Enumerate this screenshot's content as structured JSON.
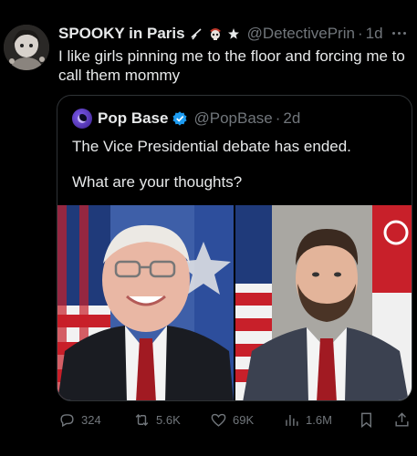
{
  "tweet": {
    "display_name": "SPOOKY in Paris",
    "name_emoji": [
      "scissors-icon",
      "pirate-skull-icon",
      "star-icon"
    ],
    "handle": "@DetectivePrin",
    "dot": "·",
    "time": "1d",
    "text": "I like girls pinning me to the floor and forcing me to call them mommy"
  },
  "quote": {
    "display_name": "Pop Base",
    "verified": true,
    "handle": "@PopBase",
    "dot": "·",
    "time": "2d",
    "line1": "The Vice Presidential debate has ended.",
    "line2": "What are your thoughts?"
  },
  "actions": {
    "replies": "324",
    "reposts": "5.6K",
    "likes": "69K",
    "views": "1.6M"
  },
  "colors": {
    "background": "#000000",
    "text": "#e7e9ea",
    "muted": "#71767b",
    "border": "#2f3336",
    "verified": "#1d9bf0"
  }
}
